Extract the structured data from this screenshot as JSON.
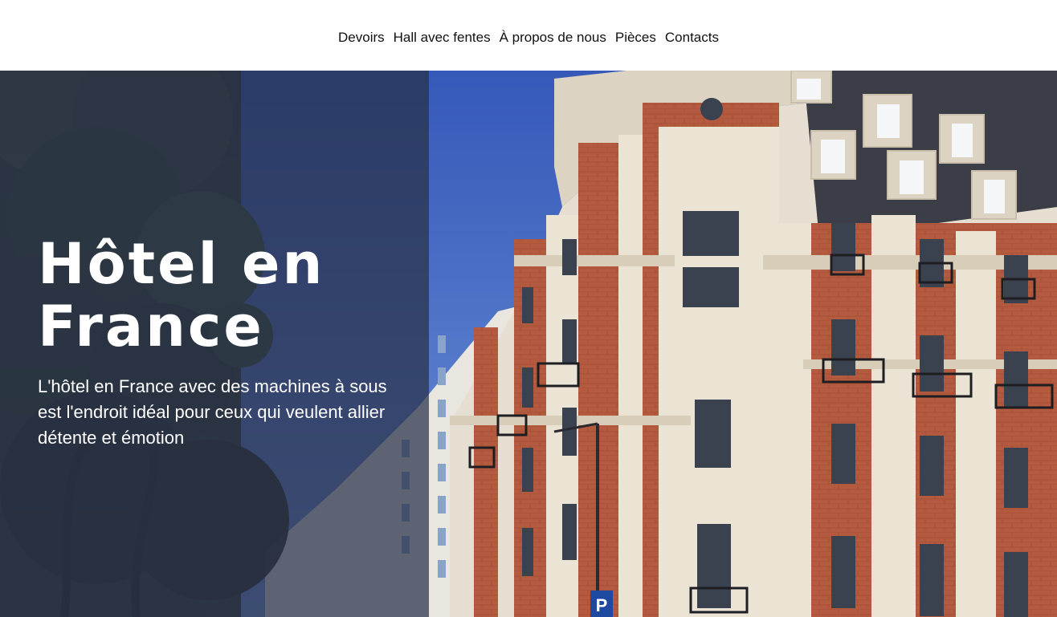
{
  "nav": {
    "items": [
      {
        "label": "Devoirs"
      },
      {
        "label": "Hall avec fentes"
      },
      {
        "label": "À propos de nous"
      },
      {
        "label": "Pièces"
      },
      {
        "label": "Contacts"
      }
    ]
  },
  "hero": {
    "title": "Hôtel en France",
    "description": "L'hôtel en France avec des machines à sous est l'endroit idéal pour ceux qui veulent allier détente et émotion",
    "parking_sign": "P"
  },
  "colors": {
    "sky": "#3f68c8",
    "brick": "#b45a3f",
    "stone": "#e6dfd1",
    "roof": "#3b3e47",
    "tree": "#2f3b2b",
    "overlay": "#28304a"
  },
  "icons": [
    "parking-sign-icon"
  ]
}
